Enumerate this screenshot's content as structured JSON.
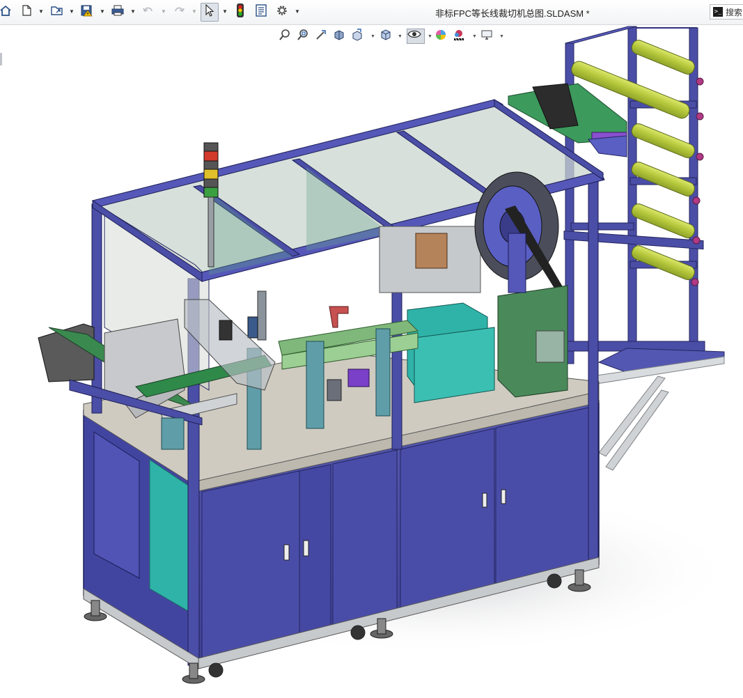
{
  "window": {
    "document_title": "非标FPC等长线裁切机总图.SLDASM *"
  },
  "toolbar": {
    "buttons": [
      {
        "name": "home",
        "icon": "home-icon"
      },
      {
        "name": "new",
        "icon": "new-document-icon"
      },
      {
        "name": "open",
        "icon": "open-folder-icon"
      },
      {
        "name": "save",
        "icon": "save-icon"
      },
      {
        "name": "print",
        "icon": "print-icon"
      },
      {
        "name": "undo",
        "icon": "undo-icon"
      },
      {
        "name": "redo",
        "icon": "redo-icon"
      },
      {
        "name": "select",
        "icon": "select-arrow-icon",
        "active": true
      },
      {
        "name": "rebuild",
        "icon": "rebuild-traffic-light-icon"
      },
      {
        "name": "file-properties",
        "icon": "file-properties-icon"
      },
      {
        "name": "options",
        "icon": "gear-icon"
      }
    ]
  },
  "search": {
    "label": "搜索"
  },
  "heads_up_toolbar": {
    "buttons": [
      {
        "name": "zoom-to-fit",
        "icon": "zoom-to-fit-icon"
      },
      {
        "name": "zoom-to-area",
        "icon": "zoom-to-area-icon"
      },
      {
        "name": "previous-view",
        "icon": "previous-view-icon"
      },
      {
        "name": "section-view",
        "icon": "section-view-icon"
      },
      {
        "name": "dynamic-annotation-views",
        "icon": "annotation-view-icon"
      },
      {
        "name": "view-orientation",
        "icon": "view-orientation-cube-icon"
      },
      {
        "name": "display-style",
        "icon": "display-style-icon"
      },
      {
        "name": "hide-show-items",
        "icon": "eye-icon",
        "active": true
      },
      {
        "name": "edit-appearance",
        "icon": "appearance-ball-icon"
      },
      {
        "name": "apply-scene",
        "icon": "scene-icon"
      },
      {
        "name": "view-settings",
        "icon": "monitor-icon"
      }
    ]
  },
  "colors": {
    "frame_blue": "#4b4ea6",
    "frame_dark": "#2d2f7a",
    "cabinet_blue": "#47489a",
    "table_top": "#cfcbc0",
    "glass": "#c9d6cf",
    "rollers_green": "#b8cc3c",
    "teal_panel": "#2fb3a8",
    "panel_light": "#d8dccf"
  }
}
